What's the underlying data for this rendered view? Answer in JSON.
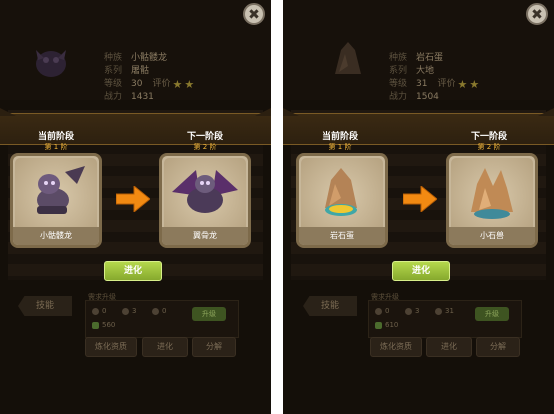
{
  "left": {
    "close_label": "✖",
    "info": {
      "race_label": "种族",
      "race_value": "小骷髅龙",
      "element_label": "系列",
      "element_value": "屠骷",
      "level_label": "等级",
      "level_value": "30",
      "rating_label": "评价",
      "stars": 2,
      "power_label": "战力",
      "power_value": "1431"
    },
    "current_stage_title": "当前阶段",
    "current_stage_num": "第 1 阶",
    "next_stage_title": "下一阶段",
    "next_stage_num": "第 2 阶",
    "current_name": "小骷髅龙",
    "next_name": "翼骨龙",
    "evolve_label": "进化",
    "skill_tab": "技能",
    "evo_req_label": "需求升级",
    "res1": "0",
    "res2": "3",
    "res3": "0",
    "res4": "560",
    "upgrade_label": "升级",
    "btn_materials": "炼化资质",
    "btn_evolve": "进化",
    "btn_decompose": "分解"
  },
  "right": {
    "close_label": "✖",
    "info": {
      "race_label": "种族",
      "race_value": "岩石蛋",
      "element_label": "系列",
      "element_value": "大地",
      "level_label": "等级",
      "level_value": "31",
      "rating_label": "评价",
      "stars": 2,
      "power_label": "战力",
      "power_value": "1504"
    },
    "current_stage_title": "当前阶段",
    "current_stage_num": "第 1 阶",
    "next_stage_title": "下一阶段",
    "next_stage_num": "第 2 阶",
    "current_name": "岩石蛋",
    "next_name": "小石兽",
    "evolve_label": "进化",
    "skill_tab": "技能",
    "evo_req_label": "需求升级",
    "res1": "0",
    "res2": "3",
    "res3": "31",
    "res4": "610",
    "upgrade_label": "升级",
    "btn_materials": "炼化资质",
    "btn_evolve": "进化",
    "btn_decompose": "分解"
  },
  "colors": {
    "accent_gold": "#f2b63a",
    "evolve_green": "#9fc23b",
    "card_bg": "#c7b79a",
    "arrow_orange": "#f28a12"
  }
}
